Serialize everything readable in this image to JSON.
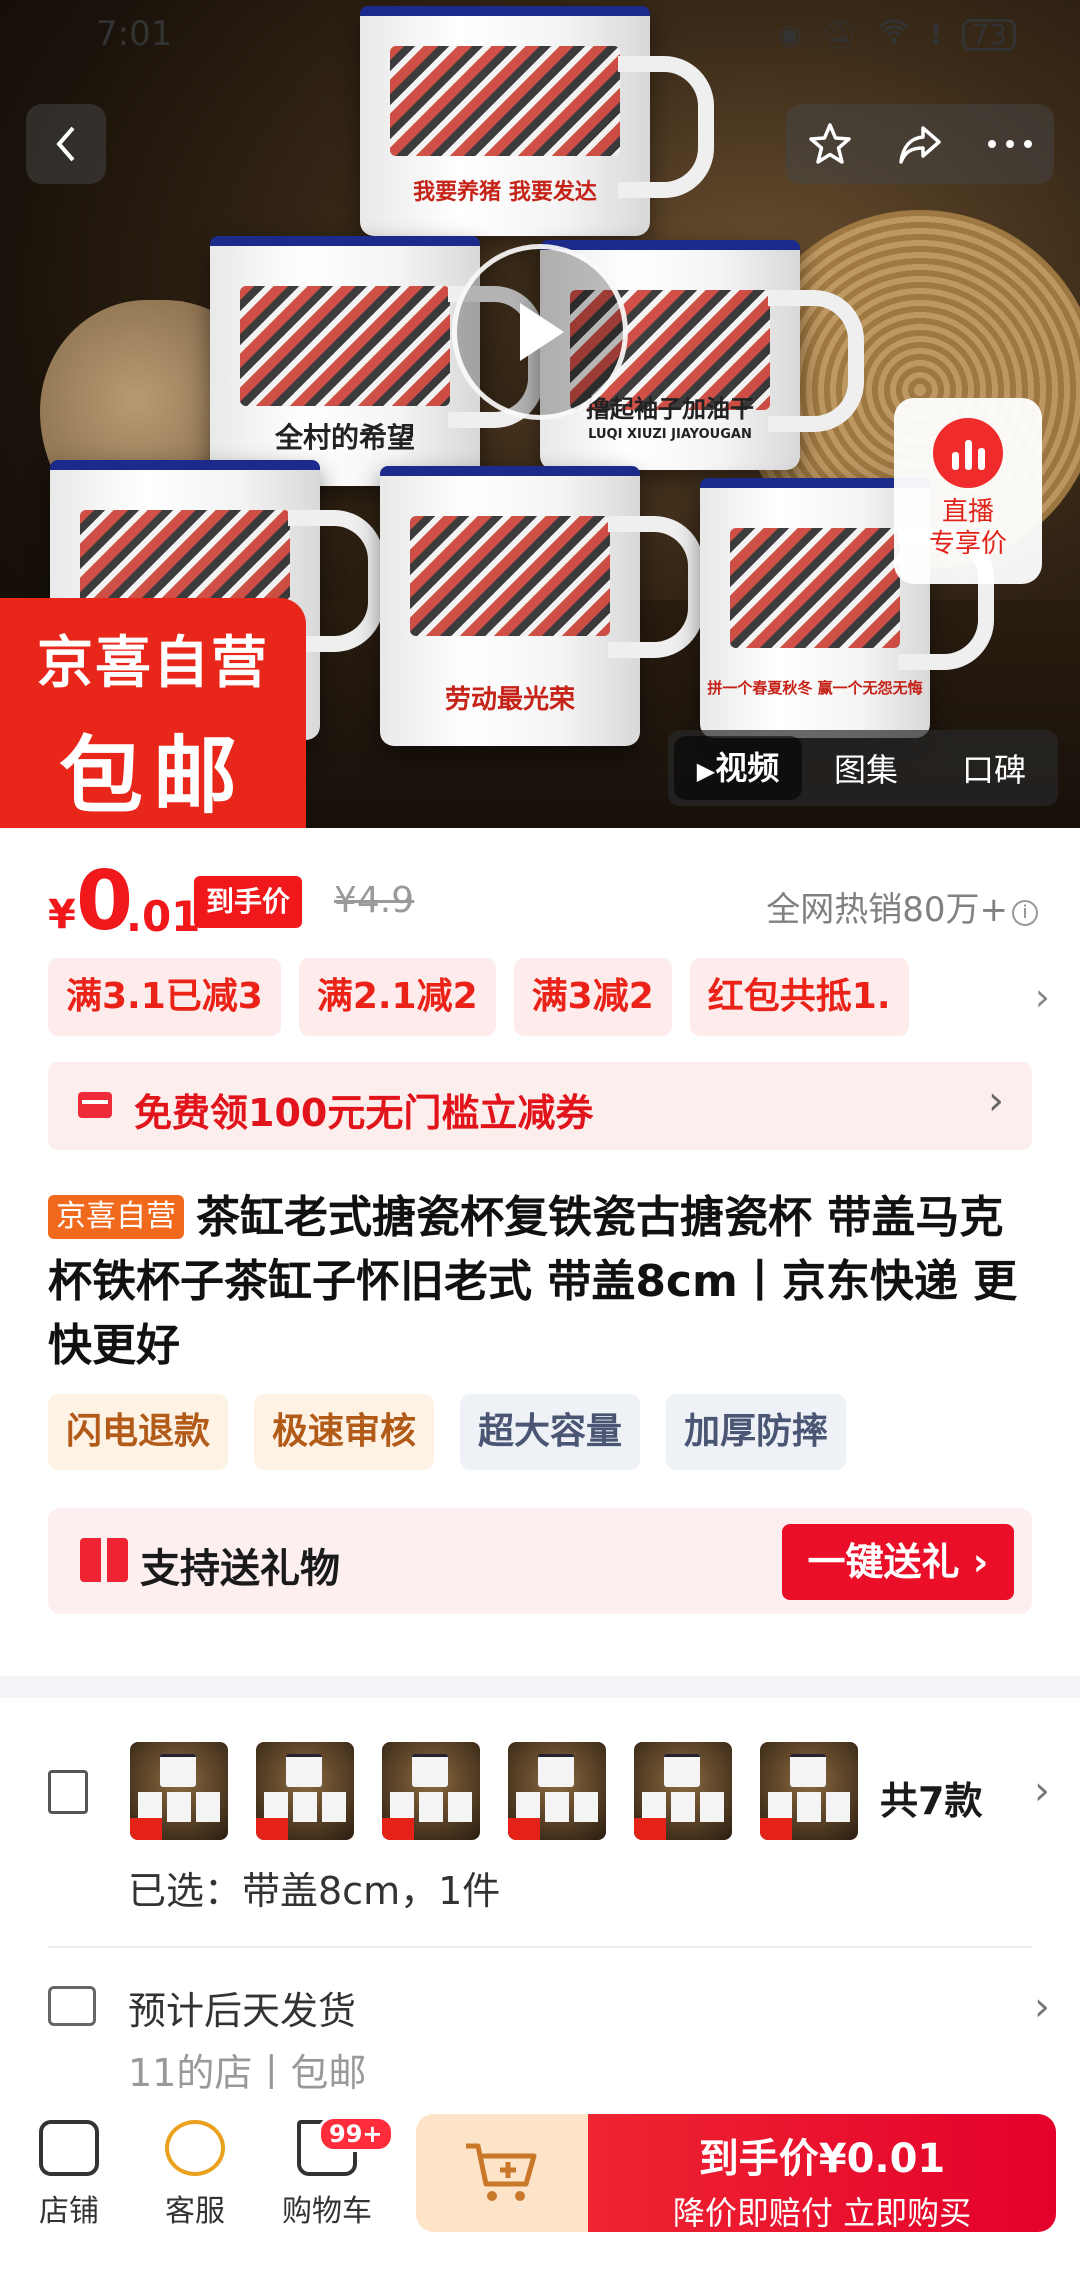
{
  "status_bar": {
    "time": "7:01",
    "battery": "73"
  },
  "hero": {
    "mug_captions": [
      "我要养猪 我要发达",
      "全村的希望",
      "撸起袖子加油干",
      "LUQI XIUZI JIAYOUGAN",
      "劳动最光荣",
      "拼一个春夏秋冬 赢一个无怨无悔"
    ],
    "live_badge": {
      "line1": "直播",
      "line2": "专享价"
    },
    "corner_badge": {
      "line1": "京喜自营",
      "line2": "包邮"
    },
    "media_tabs": [
      {
        "label": "视频",
        "icon": "play-icon"
      },
      {
        "label": "图集"
      },
      {
        "label": "口碑"
      }
    ]
  },
  "price": {
    "currency": "¥",
    "integer": "0",
    "decimal": ".01",
    "tag": "到手价",
    "original": "¥4.9",
    "hot_sales": "全网热销80万+"
  },
  "promotions": [
    "满3.1已减3",
    "满2.1减2",
    "满3减2",
    "红包共抵1."
  ],
  "coupon": {
    "text": "免费领100元无门槛立减券"
  },
  "product": {
    "tag": "京喜自营",
    "title": "茶缸老式搪瓷杯复铁瓷古搪瓷杯 带盖马克杯铁杯子茶缸子怀旧老式 带盖8cm丨京东快递 更快更好"
  },
  "features": [
    {
      "label": "闪电退款",
      "tone": "warm"
    },
    {
      "label": "极速审核",
      "tone": "warm"
    },
    {
      "label": "超大容量",
      "tone": "cool"
    },
    {
      "label": "加厚防摔",
      "tone": "cool"
    }
  ],
  "gift": {
    "text": "支持送礼物",
    "button": "一键送礼 ›"
  },
  "variants": {
    "thumbnails": [
      "variant-1",
      "variant-2",
      "variant-3",
      "variant-4",
      "variant-5",
      "variant-6"
    ],
    "count": "共7款",
    "selected": "已选：带盖8cm，1件"
  },
  "shipping": {
    "line1": "预计后天发货",
    "line2": "11的店丨包邮"
  },
  "bottom_bar": {
    "store": "店铺",
    "service": "客服",
    "cart": "购物车",
    "cart_badge": "99+",
    "buy_line1": "到手价¥0.01",
    "buy_line2": "降价即赔付 立即购买"
  },
  "colors": {
    "accent_red": "#f0181b",
    "jingxi_orange": "#f1691d",
    "add_cart_bg": "#fde3c7"
  }
}
